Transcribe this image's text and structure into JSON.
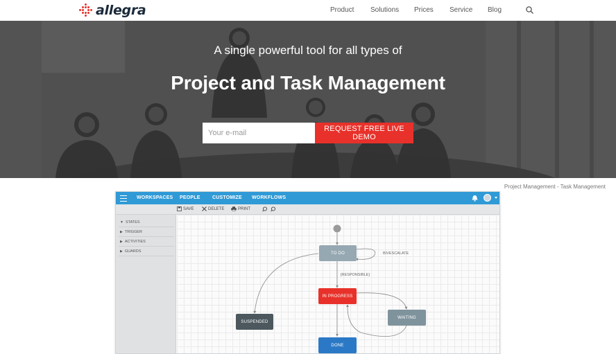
{
  "header": {
    "logo_text": "allegra",
    "nav": [
      "Product",
      "Solutions",
      "Prices",
      "Service",
      "Blog"
    ],
    "search_icon": "search-icon"
  },
  "hero": {
    "subtitle": "A single powerful tool for all types of",
    "title": "Project and Task Management",
    "email_placeholder": "Your e-mail",
    "cta_label": "REQUEST FREE LIVE DEMO"
  },
  "caption": "Project Management - Task Management",
  "app": {
    "menu": [
      "WORKSPACES",
      "PEOPLE",
      "CUSTOMIZE",
      "WORKFLOWS"
    ],
    "toolbar": {
      "save": "SAVE",
      "delete": "DELETE",
      "print": "PRINT"
    },
    "sidebar": [
      "STATES",
      "TRIGGER",
      "ACTIVITIES",
      "GUARDS"
    ],
    "workflow": {
      "nodes": {
        "todo": "TO DO",
        "in_progress": "IN PROGRESS",
        "suspended": "SUSPENDED",
        "waiting": "WAITING",
        "done": "DONE"
      },
      "labels": {
        "escalate": "BIVESCALATE",
        "responsible": "[RESPONSIBLE]"
      }
    }
  },
  "colors": {
    "brand_red": "#e8312a",
    "app_blue": "#2f9ad6",
    "node_gray": "#96a8b2",
    "node_dark": "#4c585e",
    "node_waiting": "#7f939d",
    "node_done": "#2b79c6"
  }
}
